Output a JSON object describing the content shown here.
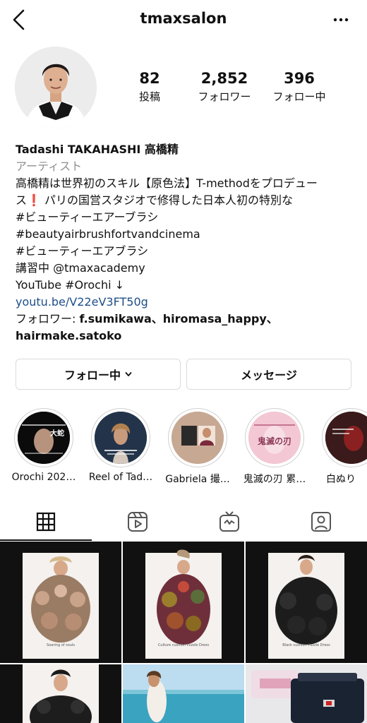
{
  "header": {
    "username": "tmaxsalon"
  },
  "stats": [
    {
      "count": "82",
      "label": "投稿"
    },
    {
      "count": "2,852",
      "label": "フォロワー"
    },
    {
      "count": "396",
      "label": "フォロー中"
    }
  ],
  "bio": {
    "name": "Tadashi TAKAHASHI 高橋精",
    "category": "アーティスト",
    "line1": "高橋精は世界初のスキル【原色法】T-methodをプロデュー",
    "line2_a": "ス",
    "line2_emoji": "❗",
    "line2_b": " パリの国営スタジオで修得した日本人初の特別な",
    "line3": "#ビューティーエアーブラシ",
    "line4": "#beautyairbrushfortvandcinema",
    "line5": "#ビューティーエアブラシ",
    "line6": "講習中 @tmaxacademy",
    "line7": "YouTube #Orochi ↓",
    "link": "youtu.be/V22eV3FT50g",
    "followed_prefix": "フォロワー: ",
    "followed_names_1": "f.sumikawa、hiromasa_happy、",
    "followed_names_2": "hairmake.satoko"
  },
  "buttons": {
    "following": "フォロー中",
    "message": "メッセージ"
  },
  "highlights": [
    {
      "label": "Orochi 202…",
      "overlay": "大蛇"
    },
    {
      "label": "Reel of Tad…",
      "overlay": ""
    },
    {
      "label": "Gabriela 撮…",
      "overlay": ""
    },
    {
      "label": "鬼滅の刃 累…",
      "overlay": "鬼滅の刃"
    },
    {
      "label": "白ぬり",
      "overlay": ""
    }
  ],
  "grid_captions": [
    "Soaring of souls",
    "Culture cushion Puzzle Dress",
    "Black cushion Puzzle Dress"
  ]
}
